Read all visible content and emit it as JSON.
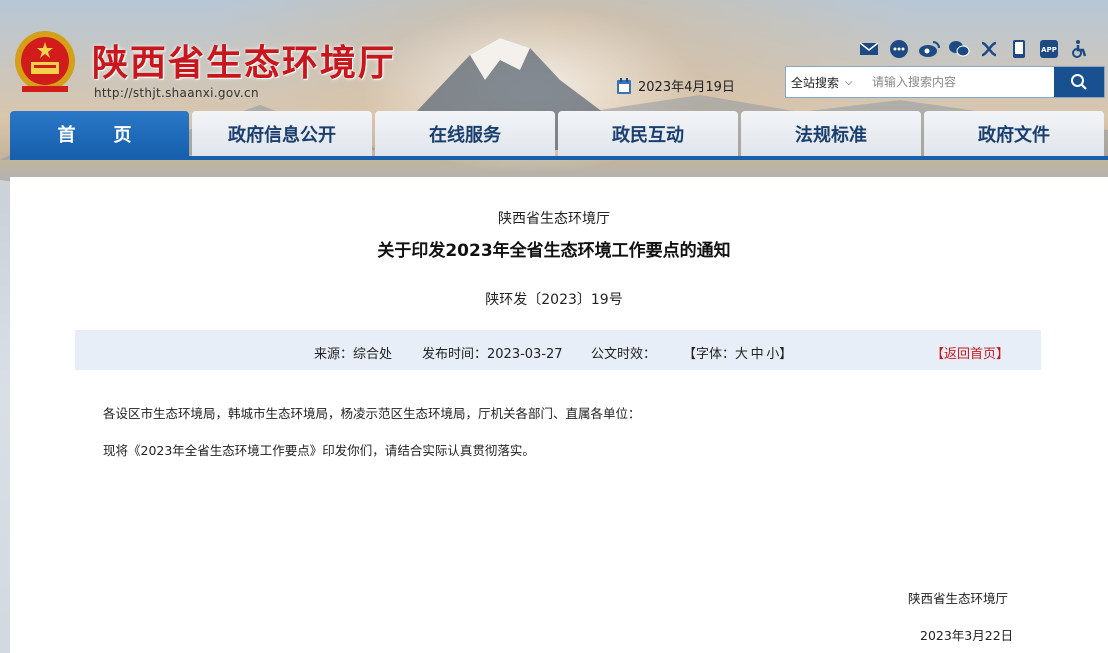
{
  "header": {
    "site_title": "陕西省生态环境厅",
    "site_url": "http://sthjt.shaanxi.gov.cn",
    "date": "2023年4月19日"
  },
  "toolbar_icons": [
    "mail-icon",
    "chat-icon",
    "weibo-icon",
    "wechat-icon",
    "miniapp-icon",
    "mobile-icon",
    "app-icon",
    "accessibility-icon"
  ],
  "search": {
    "scope": "全站搜索",
    "placeholder": "请输入搜索内容"
  },
  "nav": {
    "items": [
      "首　页",
      "政府信息公开",
      "在线服务",
      "政民互动",
      "法规标准",
      "政府文件"
    ],
    "active_index": 0
  },
  "article": {
    "issuer": "陕西省生态环境厅",
    "title": "关于印发2023年全省生态环境工作要点的通知",
    "doc_number": "陕环发〔2023〕19号",
    "meta": {
      "source": "来源：综合处",
      "publish_time": "发布时间：2023-03-27",
      "validity": "公文时效：",
      "font_label_open": "【字体：",
      "font_large": "大",
      "font_medium": "中",
      "font_small": "小",
      "font_label_close": "】",
      "back_home": "【返回首页】"
    },
    "paragraphs": [
      "各设区市生态环境局，韩城市生态环境局，杨凌示范区生态环境局，厅机关各部门、直属各单位：",
      "现将《2023年全省生态环境工作要点》印发你们，请结合实际认真贯彻落实。"
    ],
    "signature": "陕西省生态环境厅",
    "sign_date": "2023年3月22日"
  },
  "colors": {
    "brand_red": "#c8161d",
    "nav_blue": "#1760ad",
    "meta_bar": "#e8eef8"
  }
}
